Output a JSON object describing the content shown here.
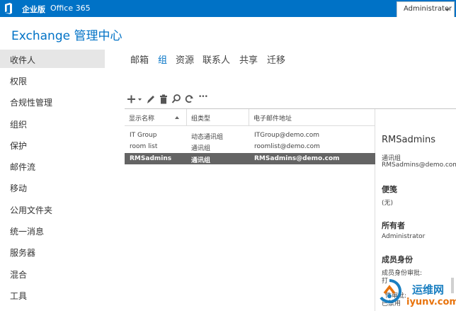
{
  "header": {
    "tabs": [
      {
        "label": "企业版",
        "active": true
      },
      {
        "label": "Office 365",
        "active": false
      }
    ],
    "user": "Administrator"
  },
  "app_title": "Exchange 管理中心",
  "sidebar": {
    "items": [
      {
        "label": "收件人",
        "selected": true
      },
      {
        "label": "权限"
      },
      {
        "label": "合规性管理"
      },
      {
        "label": "组织"
      },
      {
        "label": "保护"
      },
      {
        "label": "邮件流"
      },
      {
        "label": "移动"
      },
      {
        "label": "公用文件夹"
      },
      {
        "label": "统一消息"
      },
      {
        "label": "服务器"
      },
      {
        "label": "混合"
      },
      {
        "label": "工具"
      }
    ]
  },
  "subtabs": [
    {
      "label": "邮箱",
      "active": false
    },
    {
      "label": "组",
      "active": true
    },
    {
      "label": "资源",
      "active": false
    },
    {
      "label": "联系人",
      "active": false
    },
    {
      "label": "共享",
      "active": false
    },
    {
      "label": "迁移",
      "active": false
    }
  ],
  "toolbar": {
    "icons": [
      "add-icon",
      "edit-icon",
      "delete-icon",
      "search-icon",
      "refresh-icon",
      "more-icon"
    ],
    "more_label": "•••"
  },
  "grid": {
    "columns": [
      "显示名称",
      "组类型",
      "电子邮件地址"
    ],
    "rows": [
      {
        "name": "IT Group",
        "type": "动态通讯组",
        "email": "ITGroup@demo.com",
        "selected": false
      },
      {
        "name": "room list",
        "type": "通讯组",
        "email": "roomlist@demo.com",
        "selected": false
      },
      {
        "name": "RMSadmins",
        "type": "通讯组",
        "email": "RMSadmins@demo.com",
        "selected": true
      }
    ]
  },
  "details": {
    "title": "RMSadmins",
    "type": "通讯组",
    "email": "RMSadmins@demo.com",
    "notes_heading": "便笺",
    "notes_value": "(无)",
    "owner_heading": "所有者",
    "owner_value": "Administrator",
    "membership_heading": "成员身份",
    "membership_approval": "成员身份审批:",
    "membership_partial_1": "打",
    "membership_partial_2": "件审批:",
    "membership_partial_3": "已禁用"
  },
  "watermark": {
    "line1": "运维网",
    "line2": "iyunv.com"
  },
  "colors": {
    "brand": "#0072c6",
    "selected_row": "#646464",
    "nav_selected": "#e6e6e6"
  }
}
